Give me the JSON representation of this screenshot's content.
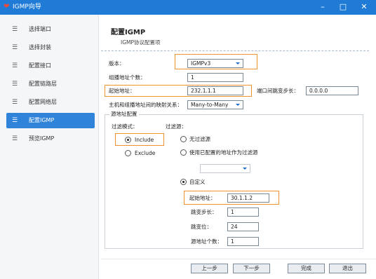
{
  "window": {
    "title": "IGMP向导",
    "minimize": "–",
    "maximize": "□",
    "close": "✕"
  },
  "sidebar": {
    "items": [
      {
        "label": "选择端口",
        "icon": "list-icon"
      },
      {
        "label": "选择封装",
        "icon": "list-icon"
      },
      {
        "label": "配置接口",
        "icon": "list-icon"
      },
      {
        "label": "配置链路层",
        "icon": "list-icon"
      },
      {
        "label": "配置网络层",
        "icon": "list-icon"
      },
      {
        "label": "配置IGMP",
        "icon": "list-icon",
        "active": true
      },
      {
        "label": "预览IGMP",
        "icon": "list-icon"
      }
    ],
    "icon_glyph": "☰"
  },
  "header": {
    "title": "配置IGMP",
    "subtitle": "IGMP协议配置项"
  },
  "form": {
    "version_label": "版本：",
    "version_value": "IGMPv3",
    "group_count_label": "组播地址个数：",
    "group_count_value": "1",
    "start_addr_label": "起始地址：",
    "start_addr_value": "232.1.1.1",
    "port_step_label": "端口间跳变步长：",
    "port_step_value": "0.0.0.0",
    "mapping_label": "主机和组播地址间的映射关系：",
    "mapping_value": "Many-to-Many"
  },
  "source": {
    "group_title": "源地址配置",
    "filter_mode_label": "过滤模式：",
    "filter_source_label": "过滤源：",
    "include_label": "Include",
    "exclude_label": "Exclude",
    "filter_mode_selected": "Include",
    "no_filter_label": "无过滤源",
    "use_configured_label": "使用已配置的地址作为过滤源",
    "configured_select_value": "",
    "custom_label": "自定义",
    "filter_source_selected": "自定义",
    "start_addr_label": "起始地址：",
    "start_addr_value": "30.1.1.2",
    "step_label": "跳变步长：",
    "step_value": "1",
    "bit_label": "跳变位：",
    "bit_value": "24",
    "count_label": "源地址个数：",
    "count_value": "1"
  },
  "footer": {
    "prev": "上一步",
    "next": "下一步",
    "finish": "完成",
    "exit": "退出"
  },
  "colors": {
    "titlebar": "#1f7bd6",
    "active_nav": "#2f83d9",
    "highlight": "#f0932e"
  }
}
